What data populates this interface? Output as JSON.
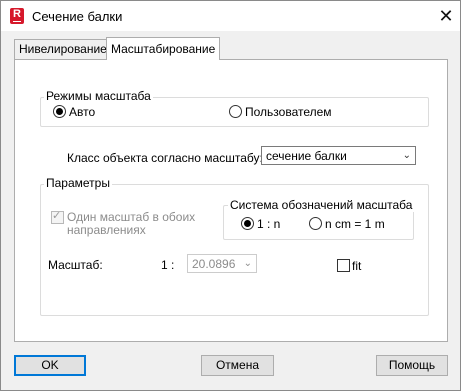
{
  "window": {
    "title": "Сечение балки",
    "app_icon_letter": "R"
  },
  "tabs": [
    {
      "label": "Нивелирование",
      "active": false
    },
    {
      "label": "Масштабирование",
      "active": true
    }
  ],
  "scale_modes": {
    "title": "Режимы масштаба",
    "options": [
      {
        "label": "Авто",
        "checked": true
      },
      {
        "label": "Пользователем",
        "checked": false
      }
    ]
  },
  "object_class": {
    "label": "Класс объекта согласно масштабу:",
    "value": "сечение балки"
  },
  "parameters": {
    "title": "Параметры",
    "same_scale": {
      "label_line1": "Один масштаб в обоих",
      "label_line2": "направлениях",
      "checked": true,
      "enabled": false
    },
    "notation": {
      "title": "Система обозначений масштаба",
      "options": [
        {
          "label": "1 : n",
          "checked": true
        },
        {
          "label": "n cm = 1 m",
          "checked": false
        }
      ]
    },
    "scale": {
      "label": "Масштаб:",
      "prefix": "1 :",
      "value": "20.0896"
    },
    "fit": {
      "label": "fit",
      "checked": false
    }
  },
  "buttons": {
    "ok": "OK",
    "cancel": "Отмена",
    "help": "Помощь"
  }
}
